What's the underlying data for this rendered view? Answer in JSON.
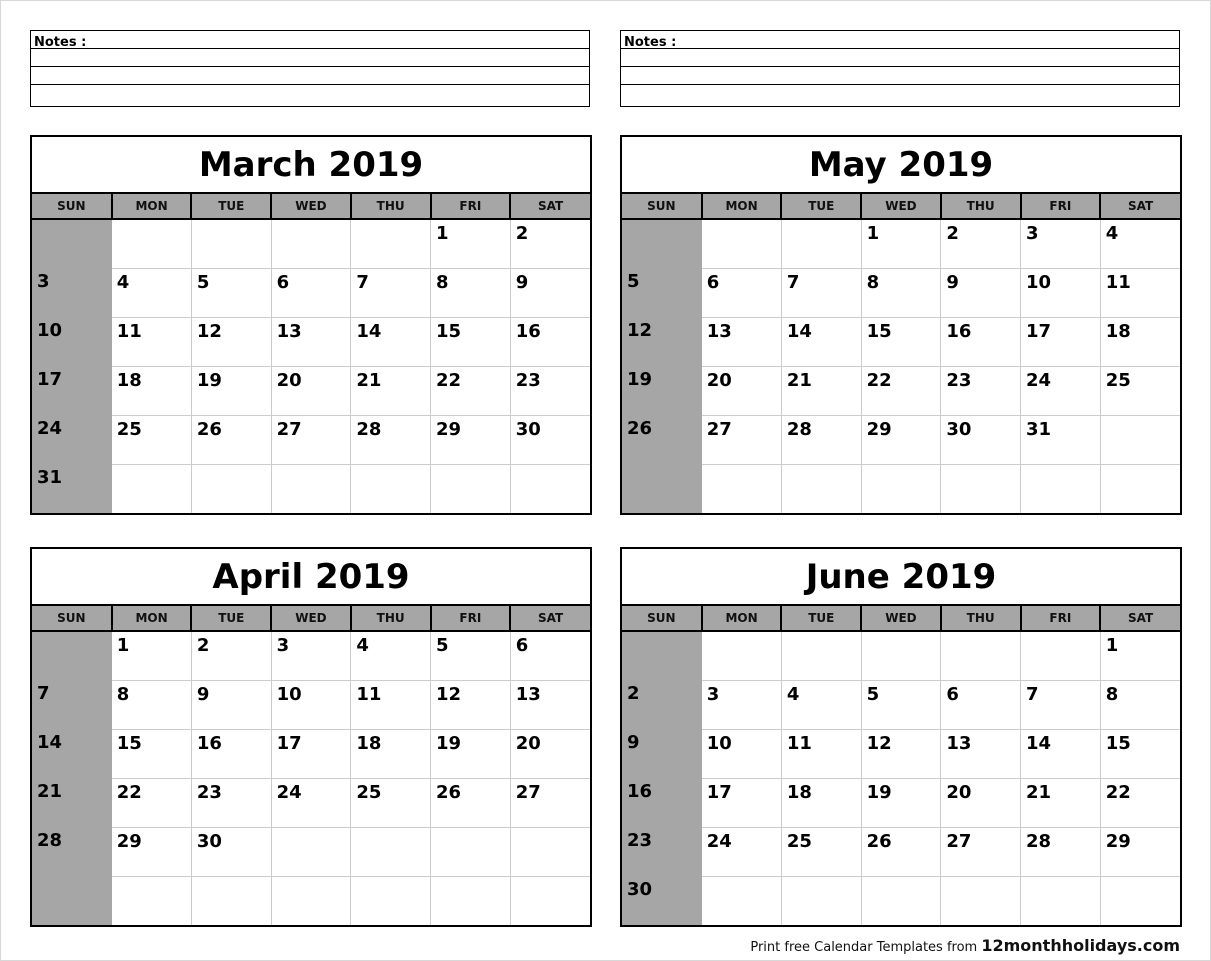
{
  "notes_label": "Notes :",
  "weekdays": [
    "SUN",
    "MON",
    "TUE",
    "WED",
    "THU",
    "FRI",
    "SAT"
  ],
  "calendars": [
    {
      "title": "March 2019",
      "start": 5,
      "days": 31
    },
    {
      "title": "May 2019",
      "start": 3,
      "days": 31
    },
    {
      "title": "April 2019",
      "start": 1,
      "days": 30
    },
    {
      "title": "June 2019",
      "start": 6,
      "days": 30
    }
  ],
  "footer": {
    "text": "Print free Calendar Templates from ",
    "site": "12monthholidays.com"
  },
  "colors": {
    "sunday_shade": "#a6a6a6",
    "header_shade": "#a6a6a6"
  }
}
